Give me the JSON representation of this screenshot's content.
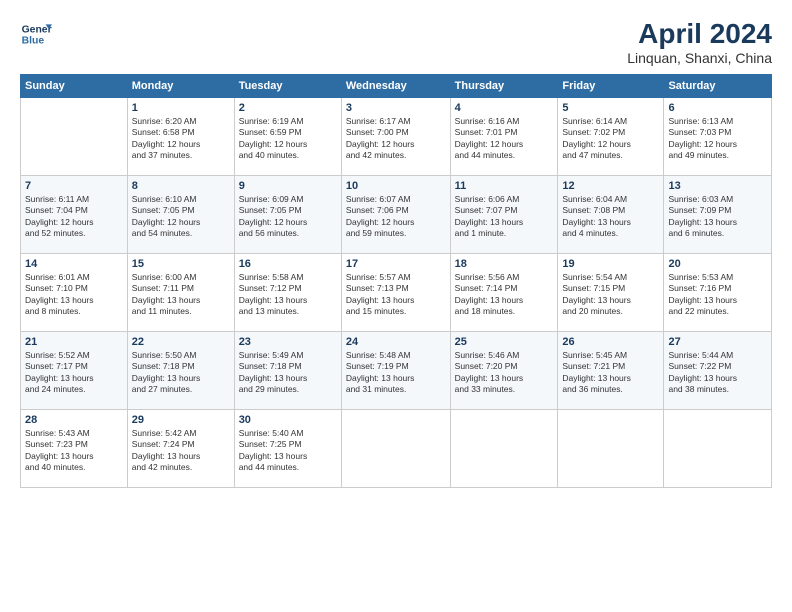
{
  "header": {
    "logo_line1": "General",
    "logo_line2": "Blue",
    "month": "April 2024",
    "location": "Linquan, Shanxi, China"
  },
  "weekdays": [
    "Sunday",
    "Monday",
    "Tuesday",
    "Wednesday",
    "Thursday",
    "Friday",
    "Saturday"
  ],
  "weeks": [
    [
      {
        "day": "",
        "info": ""
      },
      {
        "day": "1",
        "info": "Sunrise: 6:20 AM\nSunset: 6:58 PM\nDaylight: 12 hours\nand 37 minutes."
      },
      {
        "day": "2",
        "info": "Sunrise: 6:19 AM\nSunset: 6:59 PM\nDaylight: 12 hours\nand 40 minutes."
      },
      {
        "day": "3",
        "info": "Sunrise: 6:17 AM\nSunset: 7:00 PM\nDaylight: 12 hours\nand 42 minutes."
      },
      {
        "day": "4",
        "info": "Sunrise: 6:16 AM\nSunset: 7:01 PM\nDaylight: 12 hours\nand 44 minutes."
      },
      {
        "day": "5",
        "info": "Sunrise: 6:14 AM\nSunset: 7:02 PM\nDaylight: 12 hours\nand 47 minutes."
      },
      {
        "day": "6",
        "info": "Sunrise: 6:13 AM\nSunset: 7:03 PM\nDaylight: 12 hours\nand 49 minutes."
      }
    ],
    [
      {
        "day": "7",
        "info": "Sunrise: 6:11 AM\nSunset: 7:04 PM\nDaylight: 12 hours\nand 52 minutes."
      },
      {
        "day": "8",
        "info": "Sunrise: 6:10 AM\nSunset: 7:05 PM\nDaylight: 12 hours\nand 54 minutes."
      },
      {
        "day": "9",
        "info": "Sunrise: 6:09 AM\nSunset: 7:05 PM\nDaylight: 12 hours\nand 56 minutes."
      },
      {
        "day": "10",
        "info": "Sunrise: 6:07 AM\nSunset: 7:06 PM\nDaylight: 12 hours\nand 59 minutes."
      },
      {
        "day": "11",
        "info": "Sunrise: 6:06 AM\nSunset: 7:07 PM\nDaylight: 13 hours\nand 1 minute."
      },
      {
        "day": "12",
        "info": "Sunrise: 6:04 AM\nSunset: 7:08 PM\nDaylight: 13 hours\nand 4 minutes."
      },
      {
        "day": "13",
        "info": "Sunrise: 6:03 AM\nSunset: 7:09 PM\nDaylight: 13 hours\nand 6 minutes."
      }
    ],
    [
      {
        "day": "14",
        "info": "Sunrise: 6:01 AM\nSunset: 7:10 PM\nDaylight: 13 hours\nand 8 minutes."
      },
      {
        "day": "15",
        "info": "Sunrise: 6:00 AM\nSunset: 7:11 PM\nDaylight: 13 hours\nand 11 minutes."
      },
      {
        "day": "16",
        "info": "Sunrise: 5:58 AM\nSunset: 7:12 PM\nDaylight: 13 hours\nand 13 minutes."
      },
      {
        "day": "17",
        "info": "Sunrise: 5:57 AM\nSunset: 7:13 PM\nDaylight: 13 hours\nand 15 minutes."
      },
      {
        "day": "18",
        "info": "Sunrise: 5:56 AM\nSunset: 7:14 PM\nDaylight: 13 hours\nand 18 minutes."
      },
      {
        "day": "19",
        "info": "Sunrise: 5:54 AM\nSunset: 7:15 PM\nDaylight: 13 hours\nand 20 minutes."
      },
      {
        "day": "20",
        "info": "Sunrise: 5:53 AM\nSunset: 7:16 PM\nDaylight: 13 hours\nand 22 minutes."
      }
    ],
    [
      {
        "day": "21",
        "info": "Sunrise: 5:52 AM\nSunset: 7:17 PM\nDaylight: 13 hours\nand 24 minutes."
      },
      {
        "day": "22",
        "info": "Sunrise: 5:50 AM\nSunset: 7:18 PM\nDaylight: 13 hours\nand 27 minutes."
      },
      {
        "day": "23",
        "info": "Sunrise: 5:49 AM\nSunset: 7:18 PM\nDaylight: 13 hours\nand 29 minutes."
      },
      {
        "day": "24",
        "info": "Sunrise: 5:48 AM\nSunset: 7:19 PM\nDaylight: 13 hours\nand 31 minutes."
      },
      {
        "day": "25",
        "info": "Sunrise: 5:46 AM\nSunset: 7:20 PM\nDaylight: 13 hours\nand 33 minutes."
      },
      {
        "day": "26",
        "info": "Sunrise: 5:45 AM\nSunset: 7:21 PM\nDaylight: 13 hours\nand 36 minutes."
      },
      {
        "day": "27",
        "info": "Sunrise: 5:44 AM\nSunset: 7:22 PM\nDaylight: 13 hours\nand 38 minutes."
      }
    ],
    [
      {
        "day": "28",
        "info": "Sunrise: 5:43 AM\nSunset: 7:23 PM\nDaylight: 13 hours\nand 40 minutes."
      },
      {
        "day": "29",
        "info": "Sunrise: 5:42 AM\nSunset: 7:24 PM\nDaylight: 13 hours\nand 42 minutes."
      },
      {
        "day": "30",
        "info": "Sunrise: 5:40 AM\nSunset: 7:25 PM\nDaylight: 13 hours\nand 44 minutes."
      },
      {
        "day": "",
        "info": ""
      },
      {
        "day": "",
        "info": ""
      },
      {
        "day": "",
        "info": ""
      },
      {
        "day": "",
        "info": ""
      }
    ]
  ]
}
